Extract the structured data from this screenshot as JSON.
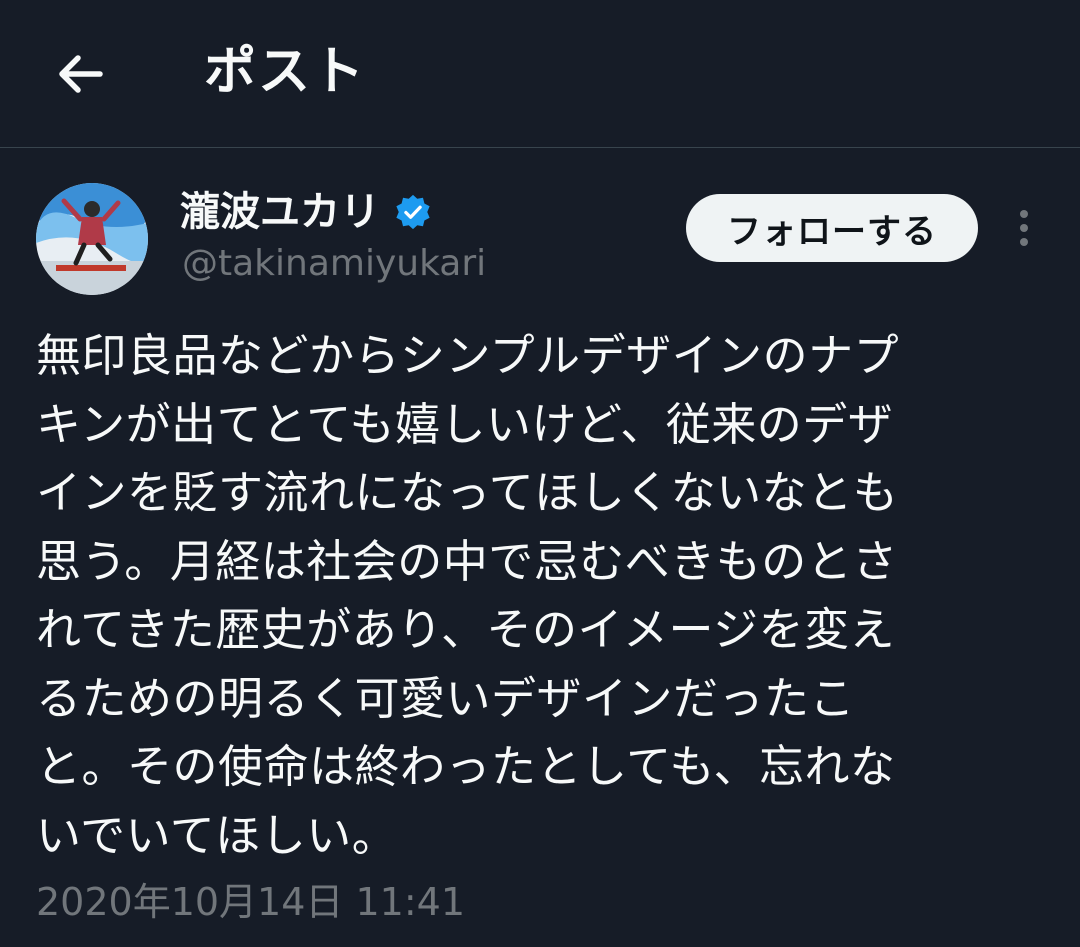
{
  "header": {
    "back_icon": "arrow-left-icon",
    "title": "ポスト"
  },
  "author": {
    "display_name": "瀧波ユカリ",
    "handle": "@takinamiyukari",
    "verified_icon": "verified-badge-icon",
    "verified_color": "#1d9bf0"
  },
  "actions": {
    "follow_label": "フォローする",
    "more_icon": "more-vertical-icon"
  },
  "tweet": {
    "text": "無印良品などからシンプルデザインのナプ\nキンが出てとても嬉しいけど、従来のデザ\nインを貶す流れになってほしくないなとも\n思う。月経は社会の中で忌むべきものとさ\nれてきた歴史があり、そのイメージを変え\nるための明るく可愛いデザインだったこ\nと。その使命は終わったとしても、忘れな\nいでいてほしい。",
    "timestamp": "2020年10月14日 11:41"
  },
  "colors": {
    "background": "#161c27",
    "text_primary": "#f7f9f9",
    "text_secondary": "#71767b",
    "divider": "#38444d",
    "follow_bg": "#eff3f4"
  }
}
